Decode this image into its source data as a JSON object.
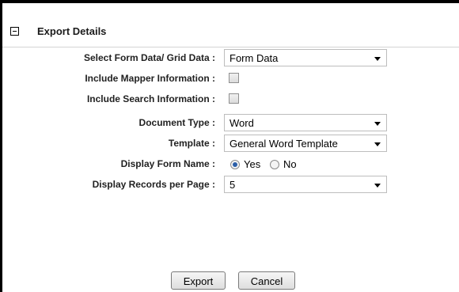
{
  "section": {
    "title": "Export Details"
  },
  "fields": {
    "form_data": {
      "label": "Select Form Data/ Grid Data :",
      "value": "Form Data"
    },
    "mapper_info": {
      "label": "Include Mapper Information :"
    },
    "search_info": {
      "label": "Include Search Information :"
    },
    "document_type": {
      "label": "Document Type :",
      "value": "Word"
    },
    "template": {
      "label": "Template :",
      "value": "General Word Template"
    },
    "display_form_name": {
      "label": "Display Form Name :",
      "yes_label": "Yes",
      "no_label": "No"
    },
    "records_per_page": {
      "label": "Display Records per Page :",
      "value": "5"
    }
  },
  "buttons": {
    "export_label": "Export",
    "cancel_label": "Cancel"
  },
  "colors": {
    "radio_selected": "#2b5ea8",
    "field_border": "#bdbdbd"
  }
}
